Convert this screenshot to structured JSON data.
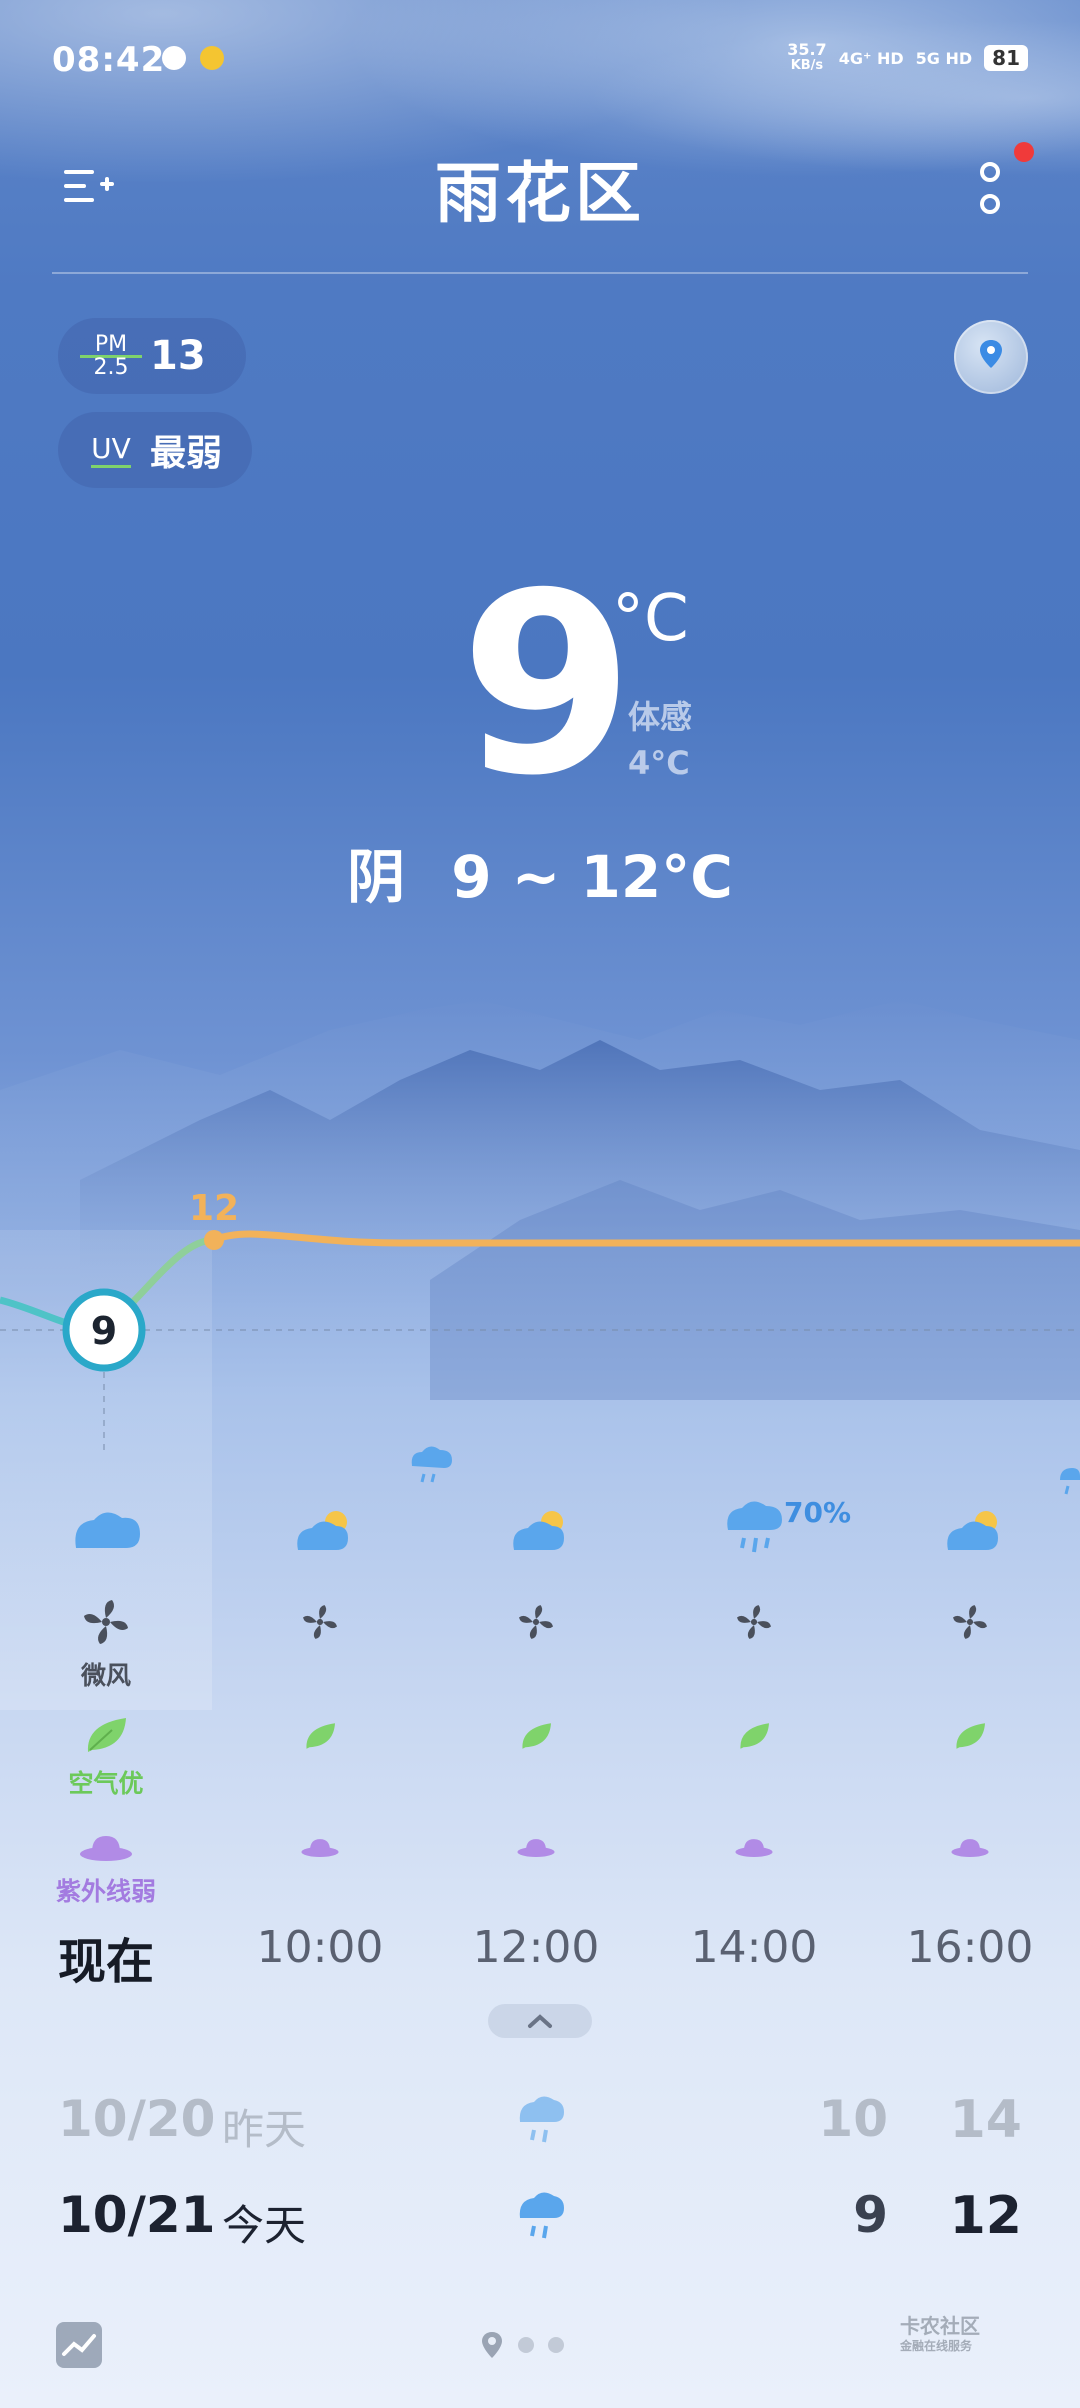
{
  "status_bar": {
    "time": "08:42",
    "net_speed": "35.7",
    "net_unit": "KB/s",
    "sim1": "4G⁺ HD",
    "sim2": "5G HD",
    "battery": "81"
  },
  "header": {
    "city": "雨花区",
    "menu_icon": "list-add-icon",
    "more_icon": "more-vertical-icon",
    "notification_dot_color": "#f03a3a"
  },
  "indicators": {
    "pm_label_top": "PM",
    "pm_label_bottom": "2.5",
    "pm_value": "13",
    "uv_label": "UV",
    "uv_value": "最弱"
  },
  "current": {
    "temp": "9",
    "unit": "°C",
    "feels_label": "体感",
    "feels_value": "4°C",
    "condition": "阴",
    "range": "9 ~ 12°C"
  },
  "hourly_chart": {
    "now_temp": "9",
    "next_temp": "12",
    "line_color": "#f2b25a",
    "past_color": "#4fc3c7"
  },
  "hourly": [
    {
      "time": "现在",
      "icon": "cloud-icon",
      "wind": "微风",
      "air": "空气优",
      "uv": "紫外线弱"
    },
    {
      "time": "10:00",
      "icon": "cloud-sun-icon"
    },
    {
      "time": "12:00",
      "icon": "cloud-sun-icon"
    },
    {
      "time": "14:00",
      "icon": "rain-icon",
      "precip": "70%"
    },
    {
      "time": "16:00",
      "icon": "cloud-sun-icon"
    }
  ],
  "daily": [
    {
      "date": "10/20",
      "name": "昨天",
      "icon": "rain-icon",
      "low": "10",
      "high": "14"
    },
    {
      "date": "10/21",
      "name": "今天",
      "icon": "rain-icon",
      "low": "9",
      "high": "12"
    }
  ],
  "footer": {
    "watermark_top": "卡农社区",
    "watermark_bottom": "金融在线服务"
  },
  "colors": {
    "sky": "#4b77c1",
    "wind_green": "#7fd36b",
    "uv_purple": "#b18be6",
    "accent_orange": "#f2b25a"
  }
}
